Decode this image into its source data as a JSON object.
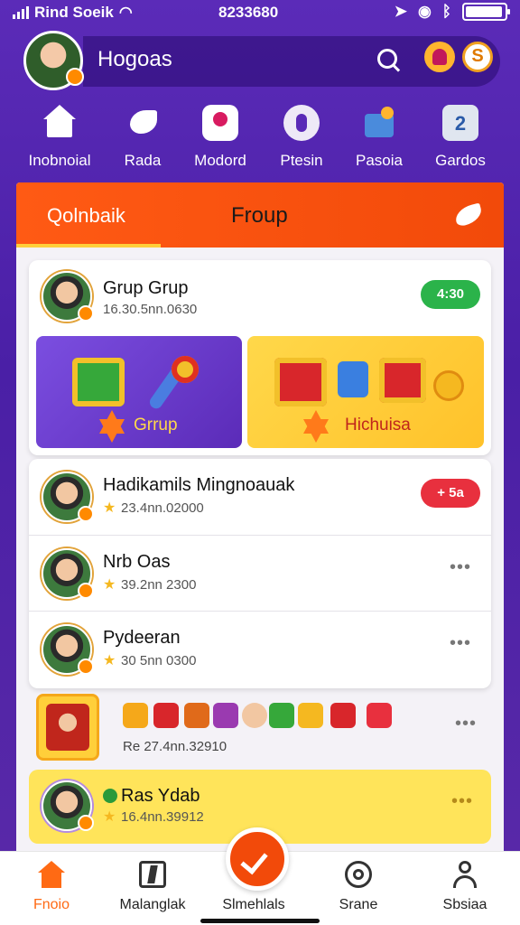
{
  "status_bar": {
    "carrier": "Rind Soeik",
    "time": "8233680"
  },
  "header": {
    "title": "Hogoas"
  },
  "quick_nav": [
    {
      "label": "Inobnoial",
      "icon": "home-icon"
    },
    {
      "label": "Rada",
      "icon": "bird-icon"
    },
    {
      "label": "Modord",
      "icon": "model-icon"
    },
    {
      "label": "Ptesin",
      "icon": "pen-icon"
    },
    {
      "label": "Pasoia",
      "icon": "package-icon"
    },
    {
      "label": "Gardos",
      "icon": "games-icon"
    }
  ],
  "tabs": [
    {
      "label": "Qolnbaik",
      "active": true
    },
    {
      "label": "Froup",
      "active": false
    }
  ],
  "group_card": {
    "name": "Grup Grup",
    "meta": "16.30.5nn.0630",
    "pill": "4:30",
    "promo_left_label": "Grrup",
    "promo_right_label": "Hichuisa"
  },
  "list": [
    {
      "name": "Hadikamils Mingnoauak",
      "meta": "23.4nn.02000",
      "pill": "+ 5a"
    },
    {
      "name": "Nrb Oas",
      "meta": "39.2nn 2300"
    },
    {
      "name": "Pydeeran",
      "meta": "30 5nn 0300"
    }
  ],
  "sticker_row": {
    "meta": "Re 27.4nn.32910"
  },
  "highlight_row": {
    "name": "Ras Ydab",
    "meta": "16.4nn.39912"
  },
  "bottom_nav": [
    {
      "label": "Fnoio",
      "active": true
    },
    {
      "label": "Malanglak",
      "active": false
    },
    {
      "label": "Slmehlals",
      "active": false
    },
    {
      "label": "Srane",
      "active": false
    },
    {
      "label": "Sbsiaa",
      "active": false
    }
  ],
  "colors": {
    "primary_purple": "#5b2bb8",
    "accent_orange": "#ff5a14",
    "highlight_yellow": "#ffe45a",
    "green_pill": "#2bb34a",
    "red_pill": "#e8303e"
  }
}
